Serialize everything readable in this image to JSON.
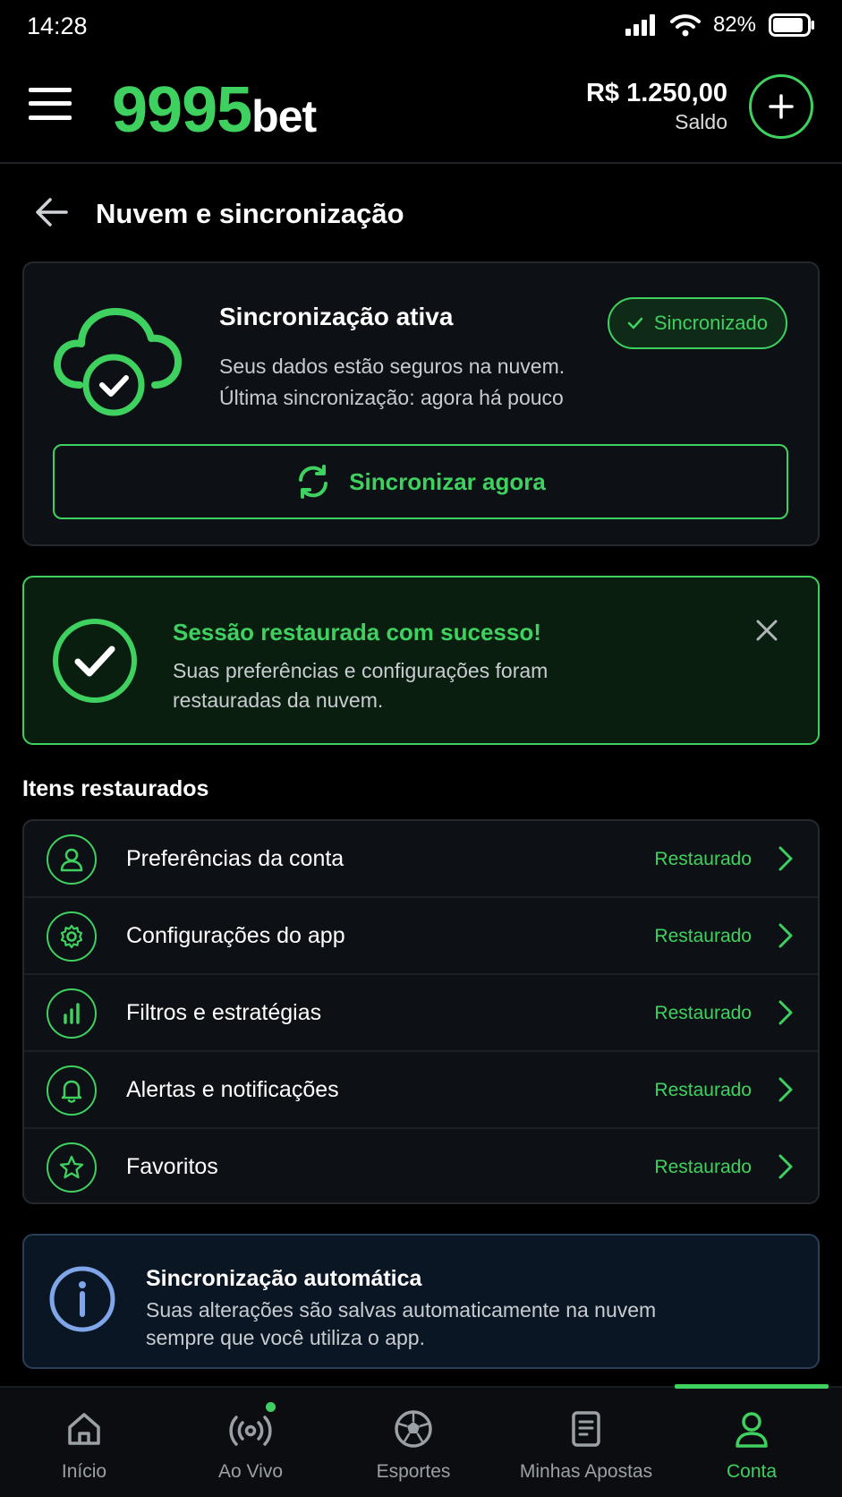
{
  "status_bar": {
    "time": "14:28",
    "battery": "82%",
    "icons": [
      "signal-icon",
      "wifi-icon",
      "battery-icon"
    ]
  },
  "header": {
    "logo_number": "9995",
    "logo_suffix": "bet",
    "balance": "R$ 1.250,00",
    "balance_label": "Saldo",
    "add_icon": "plus-icon"
  },
  "page": {
    "title": "Nuvem e sincronização",
    "back_icon": "arrow-left-icon"
  },
  "sync_card": {
    "title": "Sincronização ativa",
    "desc_line1": "Seus dados estão seguros na nuvem.",
    "desc_line2": "Última sincronização: agora há pouco",
    "badge": "Sincronizado",
    "button": "Sincronizar agora"
  },
  "success_banner": {
    "title": "Sessão restaurada com sucesso!",
    "desc": "Suas preferências e configurações foram restauradas da nuvem."
  },
  "restored": {
    "section_title": "Itens restaurados",
    "items": [
      {
        "label": "Preferências da conta",
        "status": "Restaurado",
        "icon": "user-icon"
      },
      {
        "label": "Configurações do app",
        "status": "Restaurado",
        "icon": "gear-icon"
      },
      {
        "label": "Filtros e estratégias",
        "status": "Restaurado",
        "icon": "bar-chart-icon"
      },
      {
        "label": "Alertas e notificações",
        "status": "Restaurado",
        "icon": "bell-icon"
      },
      {
        "label": "Favoritos",
        "status": "Restaurado",
        "icon": "star-icon"
      }
    ]
  },
  "info_card": {
    "title": "Sincronização automática",
    "desc": "Suas alterações são salvas automaticamente na nuvem sempre que você utiliza o app."
  },
  "bottom_nav": {
    "items": [
      {
        "label": "Início",
        "icon": "home-icon"
      },
      {
        "label": "Ao Vivo",
        "icon": "live-broadcast-icon"
      },
      {
        "label": "Esportes",
        "icon": "soccer-ball-icon"
      },
      {
        "label": "Minhas Apostas",
        "icon": "bet-slip-icon"
      },
      {
        "label": "Conta",
        "icon": "user-icon"
      }
    ],
    "active": "Conta"
  },
  "colors": {
    "accent": "#3fd15f",
    "background": "#000000",
    "card": "#0d1014",
    "info_card": "#0b1624"
  }
}
